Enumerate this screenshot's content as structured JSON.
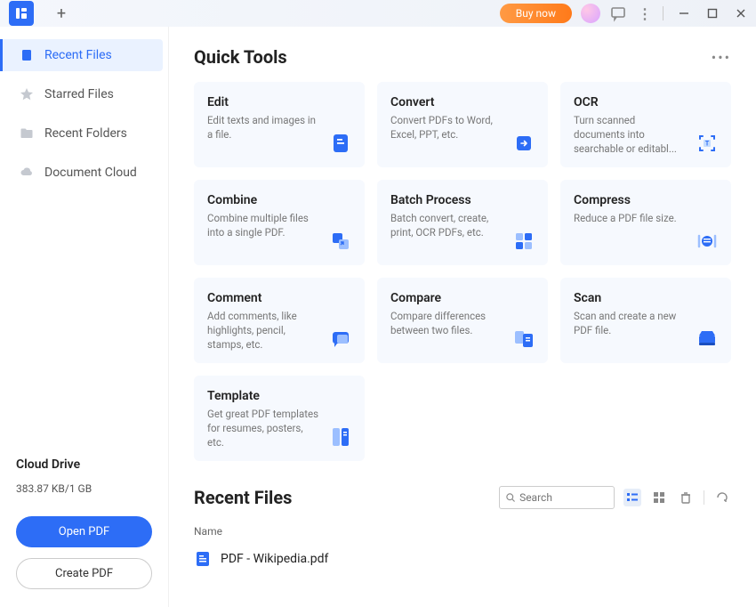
{
  "titlebar": {
    "buy_now": "Buy now"
  },
  "sidebar": {
    "items": [
      {
        "label": "Recent Files"
      },
      {
        "label": "Starred Files"
      },
      {
        "label": "Recent Folders"
      },
      {
        "label": "Document Cloud"
      }
    ]
  },
  "cloud_drive": {
    "title": "Cloud Drive",
    "usage": "383.87 KB/1 GB",
    "open_pdf": "Open PDF",
    "create_pdf": "Create PDF"
  },
  "quick_tools": {
    "title": "Quick Tools",
    "cards": [
      {
        "title": "Edit",
        "desc": "Edit texts and images in a file."
      },
      {
        "title": "Convert",
        "desc": "Convert PDFs to Word, Excel, PPT, etc."
      },
      {
        "title": "OCR",
        "desc": "Turn scanned documents into searchable or editabl..."
      },
      {
        "title": "Combine",
        "desc": "Combine multiple files into a single PDF."
      },
      {
        "title": "Batch Process",
        "desc": "Batch convert, create, print, OCR PDFs, etc."
      },
      {
        "title": "Compress",
        "desc": "Reduce a PDF file size."
      },
      {
        "title": "Comment",
        "desc": "Add comments, like highlights, pencil, stamps, etc."
      },
      {
        "title": "Compare",
        "desc": "Compare differences between two files."
      },
      {
        "title": "Scan",
        "desc": "Scan and create a new PDF file."
      },
      {
        "title": "Template",
        "desc": "Get great PDF templates for resumes, posters, etc."
      }
    ]
  },
  "recent_files": {
    "title": "Recent Files",
    "search_placeholder": "Search",
    "name_header": "Name",
    "items": [
      {
        "name": "PDF - Wikipedia.pdf"
      }
    ]
  }
}
